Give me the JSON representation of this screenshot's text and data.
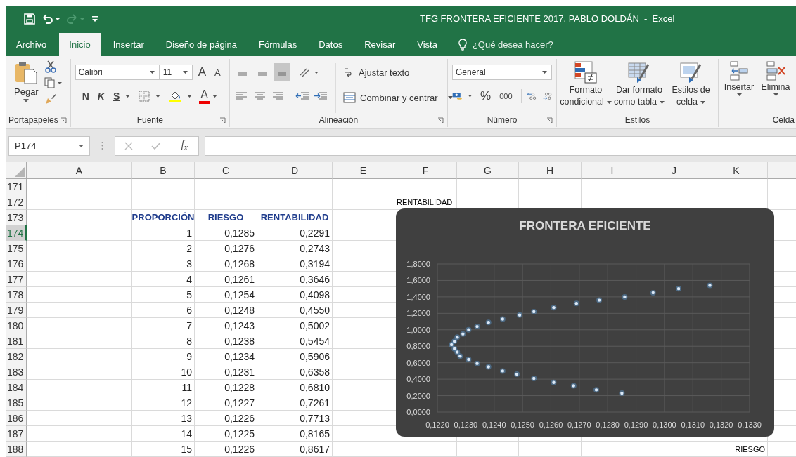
{
  "window": {
    "title": "TFG FRONTERA EFICIENTE 2017. PABLO DOLDÁN  -  Excel"
  },
  "tabs": [
    {
      "label": "Archivo",
      "selected": false
    },
    {
      "label": "Inicio",
      "selected": true
    },
    {
      "label": "Insertar",
      "selected": false
    },
    {
      "label": "Diseño de página",
      "selected": false
    },
    {
      "label": "Fórmulas",
      "selected": false
    },
    {
      "label": "Datos",
      "selected": false
    },
    {
      "label": "Revisar",
      "selected": false
    },
    {
      "label": "Vista",
      "selected": false
    }
  ],
  "tell_me": {
    "placeholder": "¿Qué desea hacer?"
  },
  "ribbon": {
    "clipboard": {
      "paste": "Pegar",
      "label": "Portapapeles"
    },
    "font": {
      "family": "Calibri",
      "size": "11",
      "grow": "A",
      "shrink": "A",
      "bold": "N",
      "italic": "K",
      "underline": "S",
      "font_color": "A",
      "label": "Fuente"
    },
    "alignment": {
      "vertical": [
        {
          "selected": false
        },
        {
          "selected": false
        },
        {
          "selected": true
        }
      ],
      "wrap_text": "Ajustar texto",
      "merge": "Combinar y centrar",
      "label": "Alineación"
    },
    "number": {
      "format": "General",
      "percent": "%",
      "thousands": "000",
      "label": "Número"
    },
    "styles": {
      "buttons": [
        {
          "lines": [
            "Formato",
            "condicional"
          ]
        },
        {
          "lines": [
            "Dar formato",
            "como tabla"
          ]
        },
        {
          "lines": [
            "Estilos de",
            "celda"
          ]
        }
      ],
      "label": "Estilos"
    },
    "cells": {
      "buttons": [
        "Insertar",
        "Elimina"
      ],
      "label": "Celda"
    }
  },
  "formula_bar": {
    "name_box": "P174",
    "function_label": "f$_{x}$"
  },
  "grid": {
    "columns": [
      "A",
      "B",
      "C",
      "D",
      "E",
      "F",
      "G",
      "H",
      "I",
      "J",
      "K"
    ],
    "rows": [
      {
        "number": "171",
        "selected": false,
        "kind": "blank"
      },
      {
        "number": "172",
        "selected": false,
        "kind": "axis_title",
        "cells": [
          "",
          "",
          "",
          "",
          "",
          "RENTABILIDAD"
        ]
      },
      {
        "number": "173",
        "selected": false,
        "kind": "heading",
        "cells": [
          "",
          "PROPORCIÓN",
          "RIESGO",
          "RENTABILIDAD"
        ]
      },
      {
        "number": "174",
        "selected": true,
        "kind": "data",
        "cells": [
          "",
          "1",
          "0,1285",
          "0,2291"
        ]
      },
      {
        "number": "175",
        "selected": false,
        "kind": "data",
        "cells": [
          "",
          "2",
          "0,1276",
          "0,2743"
        ]
      },
      {
        "number": "176",
        "selected": false,
        "kind": "data",
        "cells": [
          "",
          "3",
          "0,1268",
          "0,3194"
        ]
      },
      {
        "number": "177",
        "selected": false,
        "kind": "data",
        "cells": [
          "",
          "4",
          "0,1261",
          "0,3646"
        ]
      },
      {
        "number": "178",
        "selected": false,
        "kind": "data",
        "cells": [
          "",
          "5",
          "0,1254",
          "0,4098"
        ]
      },
      {
        "number": "179",
        "selected": false,
        "kind": "data",
        "cells": [
          "",
          "6",
          "0,1248",
          "0,4550"
        ]
      },
      {
        "number": "180",
        "selected": false,
        "kind": "data",
        "cells": [
          "",
          "7",
          "0,1243",
          "0,5002"
        ]
      },
      {
        "number": "181",
        "selected": false,
        "kind": "data",
        "cells": [
          "",
          "8",
          "0,1238",
          "0,5454"
        ]
      },
      {
        "number": "182",
        "selected": false,
        "kind": "data",
        "cells": [
          "",
          "9",
          "0,1234",
          "0,5906"
        ]
      },
      {
        "number": "183",
        "selected": false,
        "kind": "data",
        "cells": [
          "",
          "10",
          "0,1231",
          "0,6358"
        ]
      },
      {
        "number": "184",
        "selected": false,
        "kind": "data",
        "cells": [
          "",
          "11",
          "0,1228",
          "0,6810"
        ]
      },
      {
        "number": "185",
        "selected": false,
        "kind": "data",
        "cells": [
          "",
          "12",
          "0,1227",
          "0,7261"
        ]
      },
      {
        "number": "186",
        "selected": false,
        "kind": "data",
        "cells": [
          "",
          "13",
          "0,1226",
          "0,7713"
        ]
      },
      {
        "number": "187",
        "selected": false,
        "kind": "data",
        "cells": [
          "",
          "14",
          "0,1225",
          "0,8165"
        ]
      },
      {
        "number": "188",
        "selected": false,
        "kind": "data",
        "cells": [
          "",
          "15",
          "0,1226",
          "0,8617",
          "",
          "",
          "",
          "",
          "",
          "",
          "RIESGO"
        ]
      }
    ]
  },
  "chart": {
    "chart_data": {
      "type": "scatter",
      "title": "FRONTERA EFICIENTE",
      "grid": true,
      "x": [
        0.1285,
        0.1276,
        0.1268,
        0.1261,
        0.1254,
        0.1248,
        0.1243,
        0.1238,
        0.1234,
        0.1231,
        0.1228,
        0.1227,
        0.1226,
        0.1225,
        0.1226,
        0.1227,
        0.1229,
        0.1231,
        0.1234,
        0.1238,
        0.1243,
        0.1249,
        0.1254,
        0.1261,
        0.1269,
        0.1277,
        0.1286,
        0.1296,
        0.1305,
        0.1316
      ],
      "series": [
        {
          "color": "#5b9bd5",
          "values": [
            0.23,
            0.27,
            0.32,
            0.36,
            0.41,
            0.46,
            0.5,
            0.55,
            0.59,
            0.64,
            0.68,
            0.73,
            0.77,
            0.82,
            0.86,
            0.91,
            0.95,
            1.0,
            1.04,
            1.09,
            1.13,
            1.18,
            1.22,
            1.27,
            1.32,
            1.36,
            1.4,
            1.45,
            1.5,
            1.54
          ]
        }
      ],
      "xlim": [
        0.122,
        0.133
      ],
      "ylim": [
        0,
        1.8
      ],
      "xticks": [
        {
          "value": 0.122,
          "label": "0,1220"
        },
        {
          "value": 0.123,
          "label": "0,1230"
        },
        {
          "value": 0.124,
          "label": "0,1240"
        },
        {
          "value": 0.125,
          "label": "0,1250"
        },
        {
          "value": 0.126,
          "label": "0,1260"
        },
        {
          "value": 0.127,
          "label": "0,1270"
        },
        {
          "value": 0.128,
          "label": "0,1280"
        },
        {
          "value": 0.129,
          "label": "0,1290"
        },
        {
          "value": 0.13,
          "label": "0,1300"
        },
        {
          "value": 0.131,
          "label": "0,1310"
        },
        {
          "value": 0.132,
          "label": "0,1320"
        },
        {
          "value": 0.133,
          "label": "0,1330"
        }
      ],
      "yticks": [
        {
          "value": 0,
          "label": "0,0000"
        },
        {
          "value": 0.2,
          "label": "0,2000"
        },
        {
          "value": 0.4,
          "label": "0,4000"
        },
        {
          "value": 0.6,
          "label": "0,6000"
        },
        {
          "value": 0.8,
          "label": "0,8000"
        },
        {
          "value": 1,
          "label": "1,0000"
        },
        {
          "value": 1.2,
          "label": "1,2000"
        },
        {
          "value": 1.4,
          "label": "1,4000"
        },
        {
          "value": 1.6,
          "label": "1,6000"
        },
        {
          "value": 1.8,
          "label": "1,8000"
        }
      ]
    }
  }
}
